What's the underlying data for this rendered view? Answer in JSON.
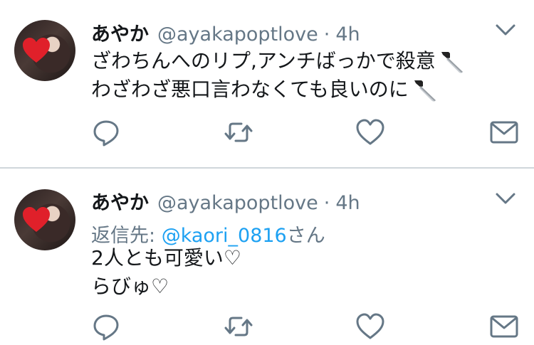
{
  "tweets": [
    {
      "author_name": "あやか",
      "handle": "@ayakapoptlove",
      "separator": "·",
      "time": "4h",
      "lines": [
        "ざわちんへのリプ,アンチばっかで殺意",
        "わざわざ悪口言わなくても良いのに"
      ],
      "emoji": "knife"
    },
    {
      "author_name": "あやか",
      "handle": "@ayakapoptlove",
      "separator": "·",
      "time": "4h",
      "reply_prefix": "返信先: ",
      "reply_mention": "@kaori_0816",
      "reply_suffix": "さん",
      "lines": [
        "2人とも可愛い♡",
        "らびゅ♡"
      ]
    }
  ],
  "icons": {
    "menu": "chevron-down-icon",
    "reply": "reply-icon",
    "retweet": "retweet-icon",
    "like": "heart-icon",
    "message": "envelope-icon",
    "emoji": "knife-icon"
  },
  "colors": {
    "text": "#14171a",
    "secondary": "#657786",
    "mention": "#1da1f2",
    "divider": "#d0d6db"
  }
}
